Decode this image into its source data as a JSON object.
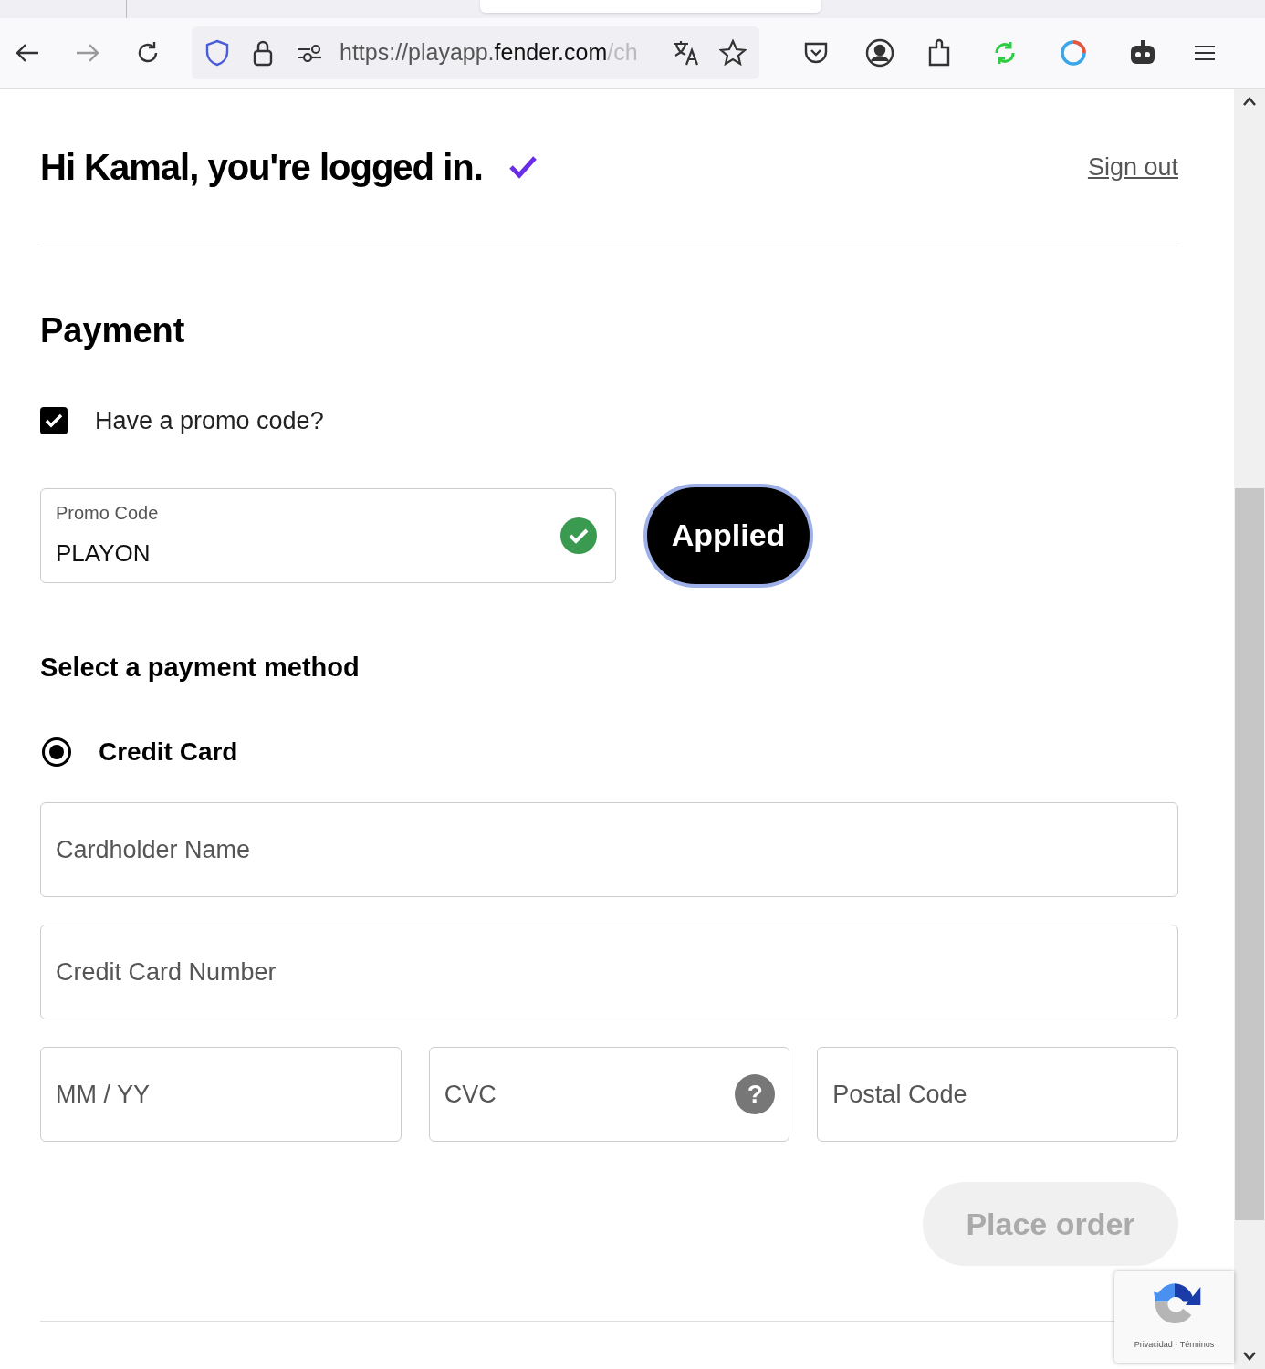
{
  "browser": {
    "url_host": "https://playapp.",
    "url_domain": "fender.com",
    "url_rest": "/ch"
  },
  "header": {
    "greeting": "Hi Kamal, you're logged in.",
    "verified": true,
    "sign_out": "Sign out"
  },
  "payment": {
    "title": "Payment",
    "promo_toggle": {
      "label": "Have a promo code?",
      "checked": true
    },
    "promo_field": {
      "label": "Promo Code",
      "value": "PLAYON",
      "valid": true
    },
    "apply_button": {
      "label": "Applied",
      "applied": true
    },
    "method_heading": "Select a payment method",
    "methods": [
      {
        "label": "Credit Card",
        "selected": true
      }
    ],
    "field_rows": [
      [
        {
          "placeholder": "Cardholder Name"
        }
      ],
      [
        {
          "placeholder": "Credit Card Number"
        }
      ],
      [
        {
          "placeholder": "MM / YY"
        },
        {
          "placeholder": "CVC",
          "help": "?"
        },
        {
          "placeholder": "Postal Code"
        }
      ]
    ],
    "place_order": {
      "label": "Place order",
      "disabled": true
    }
  },
  "recaptcha": {
    "links": "Privacidad · Términos"
  }
}
